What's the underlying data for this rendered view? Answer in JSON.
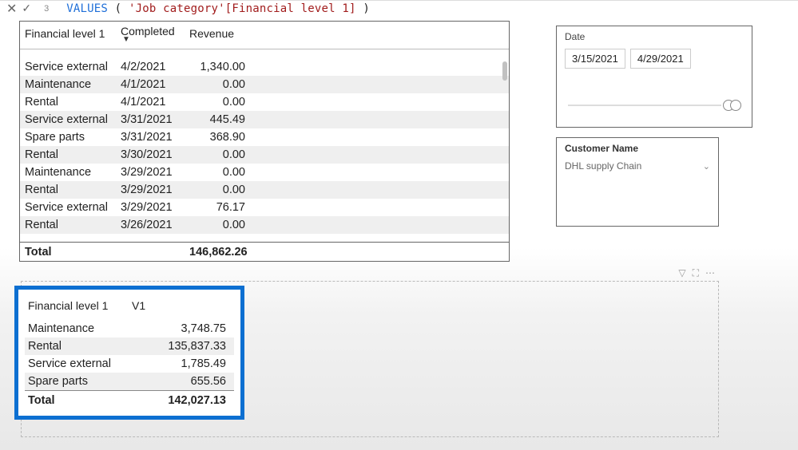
{
  "formula": {
    "line_no": "3",
    "keyword": "VALUES",
    "arg": "'Job category'[Financial level 1]"
  },
  "detail": {
    "headers": {
      "c0": "Financial level 1",
      "c1": "Completed",
      "c2": "Revenue"
    },
    "rows": [
      {
        "cat": "Service external",
        "date": "4/2/2021",
        "rev": "1,340.00"
      },
      {
        "cat": "Maintenance",
        "date": "4/1/2021",
        "rev": "0.00"
      },
      {
        "cat": "Rental",
        "date": "4/1/2021",
        "rev": "0.00"
      },
      {
        "cat": "Service external",
        "date": "3/31/2021",
        "rev": "445.49"
      },
      {
        "cat": "Spare parts",
        "date": "3/31/2021",
        "rev": "368.90"
      },
      {
        "cat": "Rental",
        "date": "3/30/2021",
        "rev": "0.00"
      },
      {
        "cat": "Maintenance",
        "date": "3/29/2021",
        "rev": "0.00"
      },
      {
        "cat": "Rental",
        "date": "3/29/2021",
        "rev": "0.00"
      },
      {
        "cat": "Service external",
        "date": "3/29/2021",
        "rev": "76.17"
      },
      {
        "cat": "Rental",
        "date": "3/26/2021",
        "rev": "0.00"
      }
    ],
    "total_label": "Total",
    "total_value": "146,862.26"
  },
  "date_slicer": {
    "label": "Date",
    "from": "3/15/2021",
    "to": "4/29/2021"
  },
  "customer_slicer": {
    "label": "Customer Name",
    "value": "DHL supply Chain"
  },
  "summary": {
    "headers": {
      "c0": "Financial level 1",
      "c1": "V1"
    },
    "rows": [
      {
        "cat": "Maintenance",
        "val": "3,748.75"
      },
      {
        "cat": "Rental",
        "val": "135,837.33"
      },
      {
        "cat": "Service external",
        "val": "1,785.49"
      },
      {
        "cat": "Spare parts",
        "val": "655.56"
      }
    ],
    "total_label": "Total",
    "total_value": "142,027.13"
  },
  "toolbar": {
    "filter": "▽",
    "focus": "⛶",
    "more": "⋯"
  }
}
